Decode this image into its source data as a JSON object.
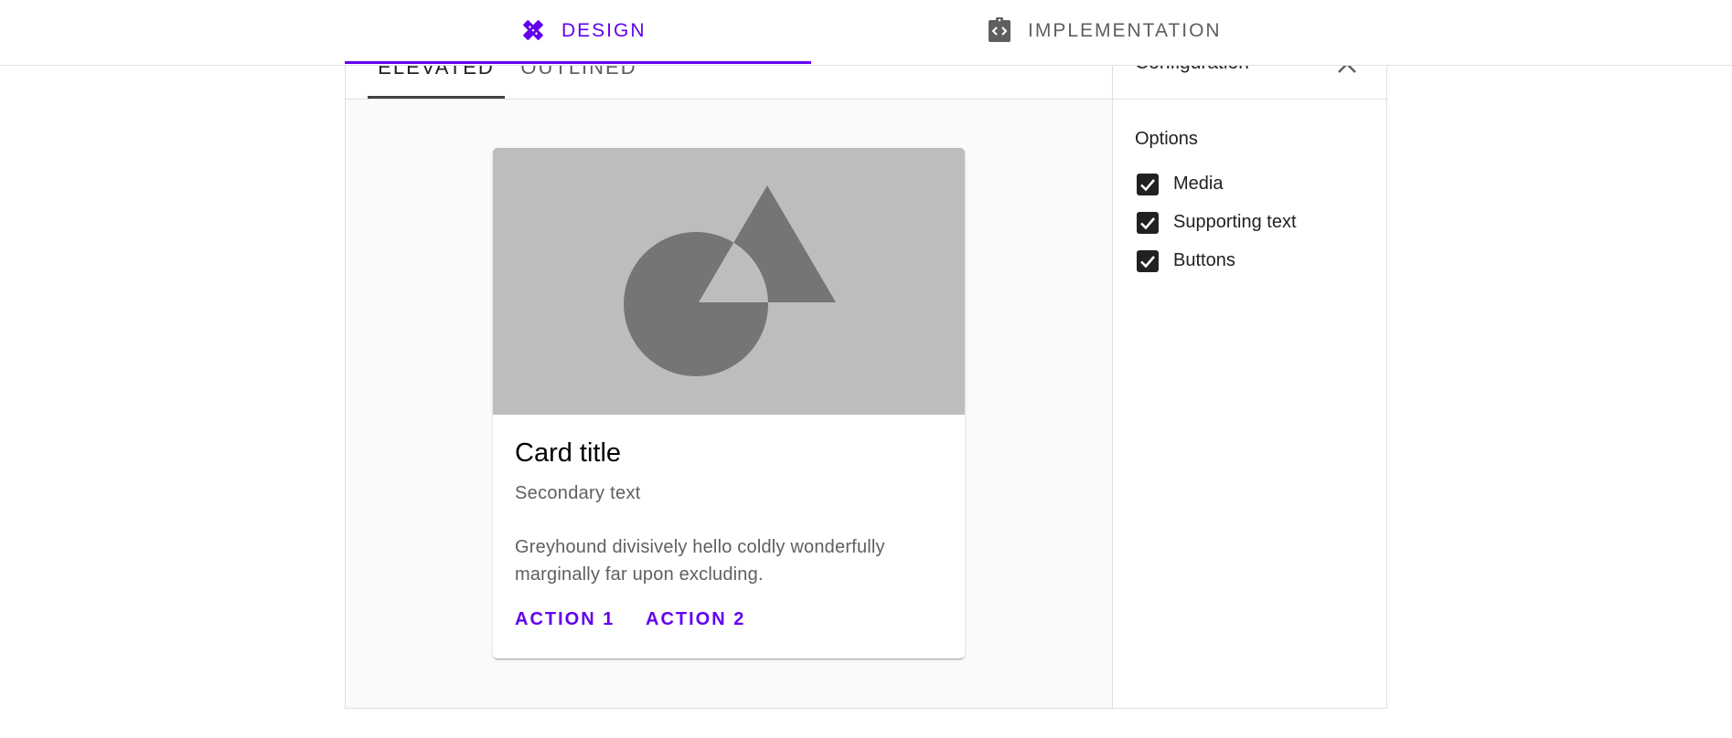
{
  "top_tabs": [
    {
      "label": "DESIGN",
      "icon": "design-tools-icon",
      "active": true
    },
    {
      "label": "IMPLEMENTATION",
      "icon": "code-clipboard-icon",
      "active": false
    }
  ],
  "demo": {
    "tabs": [
      {
        "label": "ELEVATED",
        "active": true
      },
      {
        "label": "OUTLINED",
        "active": false
      }
    ],
    "card": {
      "media_icon": "shapes-placeholder-icon",
      "title": "Card title",
      "subtitle": "Secondary text",
      "body": "Greyhound divisively hello coldly wonderfully marginally far upon excluding.",
      "actions": [
        "ACTION 1",
        "ACTION 2"
      ]
    }
  },
  "config": {
    "title": "Configuration",
    "options_label": "Options",
    "options": [
      {
        "label": "Media",
        "checked": true
      },
      {
        "label": "Supporting text",
        "checked": true
      },
      {
        "label": "Buttons",
        "checked": true
      }
    ]
  },
  "colors": {
    "accent": "#6200ee",
    "media_bg": "#bdbdbd",
    "media_shapes": "#757575",
    "stage_bg": "#fafafa"
  }
}
